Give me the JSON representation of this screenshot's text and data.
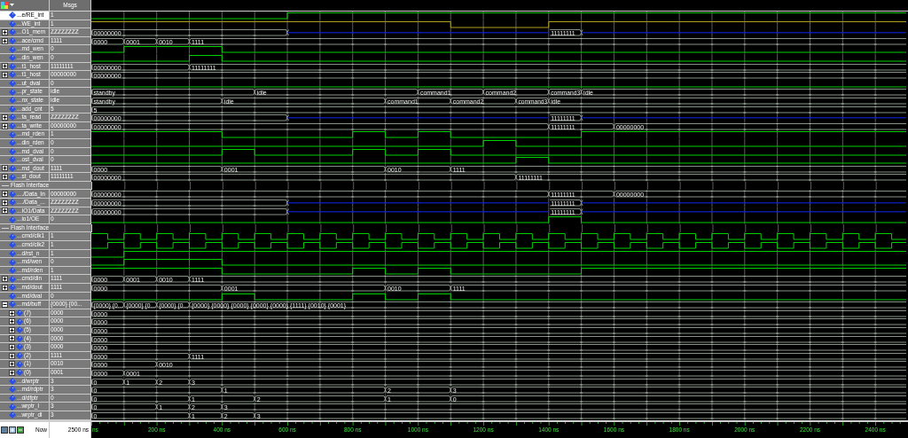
{
  "header": {
    "value_column": "Msgs"
  },
  "signals": [
    {
      "name": "...e/RE_int",
      "value": "1",
      "kind": "bit",
      "selected": true,
      "high": [
        false,
        false,
        false,
        false,
        false,
        false,
        true,
        true,
        true,
        true,
        true,
        true,
        true,
        true,
        true,
        true,
        true,
        true,
        true,
        true,
        true,
        true,
        true,
        true,
        true
      ]
    },
    {
      "name": "...WE_int",
      "value": "1",
      "kind": "bit",
      "selected": false,
      "color": "#b0a020",
      "high": [
        true,
        true,
        true,
        true,
        true,
        true,
        true,
        true,
        true,
        true,
        true,
        false,
        false,
        false,
        true,
        true,
        true,
        true,
        true,
        true,
        true,
        true,
        true,
        true,
        true
      ]
    },
    {
      "name": "...O1_mem",
      "value": "ZZZZZZZZ",
      "kind": "bus",
      "selected": false,
      "expanded": false,
      "changes": [
        true,
        false,
        false,
        false,
        false,
        false,
        true,
        false,
        false,
        false,
        false,
        false,
        false,
        false,
        true,
        true,
        false,
        false,
        false,
        false,
        false,
        false,
        false,
        false,
        false
      ],
      "segments": [
        {
          "hi_z": false,
          "label": "00000000"
        },
        {
          "hi_z": true
        },
        {
          "hi_z": false,
          "label": "11111111"
        },
        {
          "hi_z": true
        }
      ]
    },
    {
      "name": "...ace/cmd",
      "value": "1111",
      "kind": "bus",
      "selected": false,
      "expanded": false,
      "changes": [
        true,
        true,
        true,
        true,
        false,
        false,
        false,
        false,
        false,
        false,
        false,
        false,
        false,
        false,
        false,
        false,
        false,
        false,
        false,
        false,
        false,
        false,
        false,
        false,
        false
      ],
      "segments": [
        {
          "hi_z": false,
          "label": "0000"
        },
        {
          "hi_z": false,
          "label": "0001"
        },
        {
          "hi_z": false,
          "label": "0010"
        },
        {
          "hi_z": false,
          "label": "1111"
        }
      ]
    },
    {
      "name": "...md_wen",
      "value": "0",
      "kind": "bit",
      "selected": false,
      "high": [
        false,
        true,
        true,
        true,
        false,
        false,
        false,
        false,
        false,
        false,
        false,
        false,
        false,
        false,
        false,
        false,
        false,
        false,
        false,
        false,
        false,
        false,
        false,
        false,
        false
      ]
    },
    {
      "name": "...din_wen",
      "value": "0",
      "kind": "bit",
      "selected": false,
      "high": [
        false,
        false,
        false,
        true,
        false,
        false,
        false,
        false,
        false,
        false,
        false,
        false,
        false,
        false,
        false,
        false,
        false,
        false,
        false,
        false,
        false,
        false,
        false,
        false,
        false
      ]
    },
    {
      "name": "...t1_host",
      "value": "11111111",
      "kind": "bus",
      "selected": false,
      "expanded": false,
      "changes": [
        true,
        false,
        false,
        true,
        false,
        false,
        false,
        false,
        false,
        false,
        false,
        false,
        false,
        false,
        false,
        false,
        false,
        false,
        false,
        false,
        false,
        false,
        false,
        false,
        false
      ],
      "segments": [
        {
          "hi_z": false,
          "label": "00000000"
        },
        {
          "hi_z": false,
          "label": "11111111"
        }
      ]
    },
    {
      "name": "...t1_host",
      "value": "00000000",
      "kind": "bus",
      "selected": false,
      "expanded": false,
      "changes": [
        true,
        false,
        false,
        false,
        false,
        false,
        false,
        false,
        false,
        false,
        false,
        false,
        false,
        false,
        false,
        false,
        false,
        false,
        false,
        false,
        false,
        false,
        false,
        false,
        false
      ],
      "segments": [
        {
          "hi_z": false,
          "label": "00000000"
        }
      ]
    },
    {
      "name": "...ut_dval",
      "value": "0",
      "kind": "bit",
      "selected": false,
      "high": [
        false,
        false,
        false,
        false,
        false,
        false,
        false,
        false,
        false,
        false,
        false,
        false,
        false,
        false,
        false,
        false,
        false,
        false,
        false,
        false,
        false,
        false,
        false,
        false,
        false
      ]
    },
    {
      "name": "...pr_state",
      "value": "idle",
      "kind": "bus",
      "selected": false,
      "changes": [
        true,
        false,
        false,
        false,
        false,
        true,
        false,
        false,
        false,
        false,
        true,
        false,
        true,
        false,
        true,
        true,
        false,
        false,
        false,
        false,
        false,
        false,
        false,
        false,
        false
      ],
      "segments": [
        {
          "hi_z": false,
          "label": "standby"
        },
        {
          "hi_z": false,
          "label": "idle"
        },
        {
          "hi_z": false,
          "label": "command1"
        },
        {
          "hi_z": false,
          "label": "command2"
        },
        {
          "hi_z": false,
          "label": "command3"
        },
        {
          "hi_z": false,
          "label": "idle"
        }
      ]
    },
    {
      "name": "...nx_state",
      "value": "idle",
      "kind": "bus",
      "selected": false,
      "changes": [
        true,
        false,
        false,
        false,
        true,
        false,
        false,
        false,
        false,
        true,
        false,
        true,
        false,
        true,
        true,
        false,
        false,
        false,
        false,
        false,
        false,
        false,
        false,
        false,
        false
      ],
      "segments": [
        {
          "hi_z": false,
          "label": "standby"
        },
        {
          "hi_z": false,
          "label": "idle"
        },
        {
          "hi_z": false,
          "label": "command1"
        },
        {
          "hi_z": false,
          "label": "command2"
        },
        {
          "hi_z": false,
          "label": "command3"
        },
        {
          "hi_z": false,
          "label": "idle"
        }
      ]
    },
    {
      "name": "...add_cnt",
      "value": "5",
      "kind": "bus",
      "selected": false,
      "changes": [
        true,
        false,
        false,
        false,
        false,
        false,
        false,
        false,
        false,
        false,
        false,
        false,
        false,
        false,
        false,
        false,
        false,
        false,
        false,
        false,
        false,
        false,
        false,
        false,
        false
      ],
      "segments": [
        {
          "hi_z": false,
          "label": "5"
        }
      ]
    },
    {
      "name": "...ta_read",
      "value": "ZZZZZZZZ",
      "kind": "bus",
      "selected": false,
      "expanded": false,
      "changes": [
        true,
        false,
        false,
        false,
        false,
        false,
        true,
        false,
        false,
        false,
        false,
        false,
        false,
        false,
        true,
        true,
        false,
        false,
        false,
        false,
        false,
        false,
        false,
        false,
        false
      ],
      "segments": [
        {
          "hi_z": false,
          "label": "00000000"
        },
        {
          "hi_z": true
        },
        {
          "hi_z": false,
          "label": "11111111"
        },
        {
          "hi_z": true
        }
      ]
    },
    {
      "name": "...ta_write",
      "value": "00000000",
      "kind": "bus",
      "selected": false,
      "expanded": false,
      "changes": [
        true,
        false,
        false,
        false,
        false,
        false,
        false,
        false,
        false,
        false,
        false,
        false,
        false,
        false,
        true,
        false,
        true,
        false,
        false,
        false,
        false,
        false,
        false,
        false,
        false
      ],
      "segments": [
        {
          "hi_z": false,
          "label": "00000000"
        },
        {
          "hi_z": false,
          "label": "11111111"
        },
        {
          "hi_z": false,
          "label": "00000000"
        }
      ]
    },
    {
      "name": "...md_rden",
      "value": "1",
      "kind": "bit",
      "selected": false,
      "high": [
        true,
        true,
        true,
        true,
        false,
        false,
        false,
        false,
        true,
        false,
        true,
        false,
        false,
        false,
        false,
        true,
        true,
        true,
        true,
        true,
        true,
        true,
        true,
        true,
        true
      ]
    },
    {
      "name": "...din_rden",
      "value": "0",
      "kind": "bit",
      "selected": false,
      "high": [
        false,
        false,
        false,
        false,
        false,
        false,
        false,
        false,
        false,
        false,
        false,
        false,
        true,
        false,
        false,
        false,
        false,
        false,
        false,
        false,
        false,
        false,
        false,
        false,
        false
      ]
    },
    {
      "name": "...md_dval",
      "value": "0",
      "kind": "bit",
      "selected": false,
      "high": [
        false,
        false,
        false,
        false,
        true,
        false,
        false,
        false,
        true,
        false,
        true,
        false,
        false,
        false,
        false,
        false,
        false,
        false,
        false,
        false,
        false,
        false,
        false,
        false,
        false
      ]
    },
    {
      "name": "...ost_dval",
      "value": "0",
      "kind": "bit",
      "selected": false,
      "high": [
        false,
        false,
        false,
        false,
        false,
        false,
        false,
        false,
        false,
        false,
        false,
        false,
        false,
        true,
        false,
        false,
        false,
        false,
        false,
        false,
        false,
        false,
        false,
        false,
        false
      ]
    },
    {
      "name": "...md_dout",
      "value": "1111",
      "kind": "bus",
      "selected": false,
      "expanded": false,
      "changes": [
        true,
        false,
        false,
        false,
        true,
        false,
        false,
        false,
        false,
        true,
        false,
        true,
        false,
        false,
        false,
        false,
        false,
        false,
        false,
        false,
        false,
        false,
        false,
        false,
        false
      ],
      "segments": [
        {
          "hi_z": false,
          "label": "0000"
        },
        {
          "hi_z": false,
          "label": "0001"
        },
        {
          "hi_z": false,
          "label": "0010"
        },
        {
          "hi_z": false,
          "label": "1111"
        }
      ]
    },
    {
      "name": "...st_dout",
      "value": "11111111",
      "kind": "bus",
      "selected": false,
      "expanded": false,
      "changes": [
        true,
        false,
        false,
        false,
        false,
        false,
        false,
        false,
        false,
        false,
        false,
        false,
        false,
        true,
        false,
        false,
        false,
        false,
        false,
        false,
        false,
        false,
        false,
        false,
        false
      ],
      "segments": [
        {
          "hi_z": false,
          "label": "00000000"
        },
        {
          "hi_z": false,
          "label": "11111111"
        }
      ]
    },
    {
      "name": "Flash Interface",
      "kind": "divider",
      "selected": false
    },
    {
      "name": "..../Data_In",
      "value": "00000000",
      "kind": "bus",
      "selected": false,
      "expanded": false,
      "changes": [
        true,
        false,
        false,
        false,
        false,
        false,
        false,
        false,
        false,
        false,
        false,
        false,
        false,
        false,
        true,
        false,
        true,
        false,
        false,
        false,
        false,
        false,
        false,
        false,
        false
      ],
      "segments": [
        {
          "hi_z": false,
          "label": "00000000"
        },
        {
          "hi_z": false,
          "label": "11111111"
        },
        {
          "hi_z": false,
          "label": "00000000"
        }
      ]
    },
    {
      "name": "..../Data_...",
      "value": "ZZZZZZZZ",
      "kind": "bus",
      "selected": false,
      "expanded": false,
      "changes": [
        true,
        false,
        false,
        false,
        false,
        false,
        true,
        false,
        false,
        false,
        false,
        false,
        false,
        false,
        true,
        true,
        false,
        false,
        false,
        false,
        false,
        false,
        false,
        false,
        false
      ],
      "segments": [
        {
          "hi_z": false,
          "label": "00000000"
        },
        {
          "hi_z": true
        },
        {
          "hi_z": false,
          "label": "11111111"
        },
        {
          "hi_z": true
        }
      ]
    },
    {
      "name": "...IO1/Data",
      "value": "ZZZZZZZZ",
      "kind": "bus",
      "selected": false,
      "expanded": false,
      "changes": [
        true,
        false,
        false,
        false,
        false,
        false,
        true,
        false,
        false,
        false,
        false,
        false,
        false,
        false,
        true,
        true,
        false,
        false,
        false,
        false,
        false,
        false,
        false,
        false,
        false
      ],
      "segments": [
        {
          "hi_z": false,
          "label": "00000000"
        },
        {
          "hi_z": true
        },
        {
          "hi_z": false,
          "label": "11111111"
        },
        {
          "hi_z": true
        }
      ]
    },
    {
      "name": "...io1/OE",
      "value": "0",
      "kind": "bit",
      "selected": false,
      "high": [
        false,
        false,
        false,
        false,
        false,
        false,
        false,
        false,
        false,
        false,
        false,
        false,
        false,
        false,
        true,
        false,
        false,
        false,
        false,
        false,
        false,
        false,
        false,
        false,
        false
      ]
    },
    {
      "name": "Flash Interface",
      "kind": "divider",
      "selected": false
    },
    {
      "name": "...cmd/clk1",
      "value": "1",
      "kind": "clock",
      "selected": false,
      "inverted": false
    },
    {
      "name": "...cmd/clk2",
      "value": "1",
      "kind": "clock",
      "selected": false,
      "inverted": true
    },
    {
      "name": "...d/rst_n",
      "value": "1",
      "kind": "bit",
      "selected": false,
      "high": [
        false,
        true,
        true,
        true,
        true,
        true,
        true,
        true,
        true,
        true,
        true,
        true,
        true,
        true,
        true,
        true,
        true,
        true,
        true,
        true,
        true,
        true,
        true,
        true,
        true
      ]
    },
    {
      "name": "...md/wen",
      "value": "0",
      "kind": "bit",
      "selected": false,
      "high": [
        false,
        true,
        true,
        true,
        false,
        false,
        false,
        false,
        false,
        false,
        false,
        false,
        false,
        false,
        false,
        false,
        false,
        false,
        false,
        false,
        false,
        false,
        false,
        false,
        false
      ]
    },
    {
      "name": "...md/rden",
      "value": "1",
      "kind": "bit",
      "selected": false,
      "high": [
        true,
        true,
        true,
        true,
        false,
        false,
        false,
        false,
        true,
        false,
        true,
        false,
        false,
        false,
        false,
        true,
        true,
        true,
        true,
        true,
        true,
        true,
        true,
        true,
        true
      ]
    },
    {
      "name": "...cmd/din",
      "value": "1111",
      "kind": "bus",
      "selected": false,
      "expanded": false,
      "changes": [
        true,
        true,
        true,
        true,
        false,
        false,
        false,
        false,
        false,
        false,
        false,
        false,
        false,
        false,
        false,
        false,
        false,
        false,
        false,
        false,
        false,
        false,
        false,
        false,
        false
      ],
      "segments": [
        {
          "hi_z": false,
          "label": "0000"
        },
        {
          "hi_z": false,
          "label": "0001"
        },
        {
          "hi_z": false,
          "label": "0010"
        },
        {
          "hi_z": false,
          "label": "1111"
        }
      ]
    },
    {
      "name": "...md/dout",
      "value": "1111",
      "kind": "bus",
      "selected": false,
      "expanded": false,
      "changes": [
        true,
        false,
        false,
        false,
        true,
        false,
        false,
        false,
        false,
        true,
        false,
        true,
        false,
        false,
        false,
        false,
        false,
        false,
        false,
        false,
        false,
        false,
        false,
        false,
        false
      ],
      "segments": [
        {
          "hi_z": false,
          "label": "0000"
        },
        {
          "hi_z": false,
          "label": "0001"
        },
        {
          "hi_z": false,
          "label": "0010"
        },
        {
          "hi_z": false,
          "label": "1111"
        }
      ]
    },
    {
      "name": "...md/dval",
      "value": "0",
      "kind": "bit",
      "selected": false,
      "high": [
        false,
        false,
        false,
        false,
        true,
        false,
        false,
        false,
        true,
        false,
        true,
        false,
        false,
        false,
        false,
        false,
        false,
        false,
        false,
        false,
        false,
        false,
        false,
        false,
        false
      ]
    },
    {
      "name": "...md/buff",
      "value": "{0000} {00...",
      "kind": "bus",
      "selected": false,
      "expanded": true,
      "changes": [
        true,
        true,
        true,
        true,
        false,
        false,
        false,
        false,
        false,
        false,
        false,
        false,
        false,
        false,
        false,
        false,
        false,
        false,
        false,
        false,
        false,
        false,
        false,
        false,
        false
      ],
      "segments": [
        {
          "hi_z": false,
          "label": "{0000} {0..."
        },
        {
          "hi_z": false,
          "label": "{0000} {0..."
        },
        {
          "hi_z": false,
          "label": "{0000} {0..."
        },
        {
          "hi_z": false,
          "label": "{0000} {0000} {0000} {0000} {0000} {1111} {0010} {0001}"
        }
      ],
      "children": [
        {
          "name": "(7)",
          "value": "0000",
          "kind": "bus",
          "selected": false,
          "expanded": false,
          "changes": [
            true,
            false,
            false,
            false,
            false,
            false,
            false,
            false,
            false,
            false,
            false,
            false,
            false,
            false,
            false,
            false,
            false,
            false,
            false,
            false,
            false,
            false,
            false,
            false,
            false
          ],
          "segments": [
            {
              "hi_z": false,
              "label": "0000"
            }
          ]
        },
        {
          "name": "(6)",
          "value": "0000",
          "kind": "bus",
          "selected": false,
          "expanded": false,
          "changes": [
            true,
            false,
            false,
            false,
            false,
            false,
            false,
            false,
            false,
            false,
            false,
            false,
            false,
            false,
            false,
            false,
            false,
            false,
            false,
            false,
            false,
            false,
            false,
            false,
            false
          ],
          "segments": [
            {
              "hi_z": false,
              "label": "0000"
            }
          ]
        },
        {
          "name": "(5)",
          "value": "0000",
          "kind": "bus",
          "selected": false,
          "expanded": false,
          "changes": [
            true,
            false,
            false,
            false,
            false,
            false,
            false,
            false,
            false,
            false,
            false,
            false,
            false,
            false,
            false,
            false,
            false,
            false,
            false,
            false,
            false,
            false,
            false,
            false,
            false
          ],
          "segments": [
            {
              "hi_z": false,
              "label": "0000"
            }
          ]
        },
        {
          "name": "(4)",
          "value": "0000",
          "kind": "bus",
          "selected": false,
          "expanded": false,
          "changes": [
            true,
            false,
            false,
            false,
            false,
            false,
            false,
            false,
            false,
            false,
            false,
            false,
            false,
            false,
            false,
            false,
            false,
            false,
            false,
            false,
            false,
            false,
            false,
            false,
            false
          ],
          "segments": [
            {
              "hi_z": false,
              "label": "0000"
            }
          ]
        },
        {
          "name": "(3)",
          "value": "0000",
          "kind": "bus",
          "selected": false,
          "expanded": false,
          "changes": [
            true,
            false,
            false,
            false,
            false,
            false,
            false,
            false,
            false,
            false,
            false,
            false,
            false,
            false,
            false,
            false,
            false,
            false,
            false,
            false,
            false,
            false,
            false,
            false,
            false
          ],
          "segments": [
            {
              "hi_z": false,
              "label": "0000"
            }
          ]
        },
        {
          "name": "(2)",
          "value": "1111",
          "kind": "bus",
          "selected": false,
          "expanded": false,
          "changes": [
            true,
            false,
            false,
            true,
            false,
            false,
            false,
            false,
            false,
            false,
            false,
            false,
            false,
            false,
            false,
            false,
            false,
            false,
            false,
            false,
            false,
            false,
            false,
            false,
            false
          ],
          "segments": [
            {
              "hi_z": false,
              "label": "0000"
            },
            {
              "hi_z": false,
              "label": "1111"
            }
          ]
        },
        {
          "name": "(1)",
          "value": "0010",
          "kind": "bus",
          "selected": false,
          "expanded": false,
          "changes": [
            true,
            false,
            true,
            false,
            false,
            false,
            false,
            false,
            false,
            false,
            false,
            false,
            false,
            false,
            false,
            false,
            false,
            false,
            false,
            false,
            false,
            false,
            false,
            false,
            false
          ],
          "segments": [
            {
              "hi_z": false,
              "label": "0000"
            },
            {
              "hi_z": false,
              "label": "0010"
            }
          ]
        },
        {
          "name": "(0)",
          "value": "0001",
          "kind": "bus",
          "selected": false,
          "expanded": false,
          "changes": [
            true,
            true,
            false,
            false,
            false,
            false,
            false,
            false,
            false,
            false,
            false,
            false,
            false,
            false,
            false,
            false,
            false,
            false,
            false,
            false,
            false,
            false,
            false,
            false,
            false
          ],
          "segments": [
            {
              "hi_z": false,
              "label": "0000"
            },
            {
              "hi_z": false,
              "label": "0001"
            }
          ]
        }
      ]
    },
    {
      "name": "...d/wrptr",
      "value": "3",
      "kind": "bus",
      "selected": false,
      "changes": [
        true,
        true,
        true,
        true,
        false,
        false,
        false,
        false,
        false,
        false,
        false,
        false,
        false,
        false,
        false,
        false,
        false,
        false,
        false,
        false,
        false,
        false,
        false,
        false,
        false
      ],
      "segments": [
        {
          "hi_z": false,
          "label": "0"
        },
        {
          "hi_z": false,
          "label": "1"
        },
        {
          "hi_z": false,
          "label": "2"
        },
        {
          "hi_z": false,
          "label": "3"
        }
      ]
    },
    {
      "name": "...md/rdptr",
      "value": "3",
      "kind": "bus",
      "selected": false,
      "changes": [
        true,
        false,
        false,
        false,
        true,
        false,
        false,
        false,
        false,
        true,
        false,
        true,
        false,
        false,
        false,
        false,
        false,
        false,
        false,
        false,
        false,
        false,
        false,
        false,
        false
      ],
      "segments": [
        {
          "hi_z": false,
          "label": "0"
        },
        {
          "hi_z": false,
          "label": "1"
        },
        {
          "hi_z": false,
          "label": "2"
        },
        {
          "hi_z": false,
          "label": "3"
        }
      ]
    },
    {
      "name": "...d/dfptr",
      "value": "0",
      "kind": "bus",
      "selected": false,
      "changes": [
        true,
        false,
        false,
        true,
        false,
        true,
        false,
        false,
        false,
        true,
        false,
        true,
        false,
        false,
        false,
        false,
        false,
        false,
        false,
        false,
        false,
        false,
        false,
        false,
        false
      ],
      "segments": [
        {
          "hi_z": false,
          "label": "0"
        },
        {
          "hi_z": false,
          "label": "1"
        },
        {
          "hi_z": false,
          "label": "2"
        },
        {
          "hi_z": false,
          "label": "1"
        },
        {
          "hi_z": false,
          "label": "0"
        }
      ]
    },
    {
      "name": "...wrptr_l",
      "value": "3",
      "kind": "bus",
      "selected": false,
      "changes": [
        true,
        false,
        true,
        true,
        true,
        false,
        false,
        false,
        false,
        false,
        false,
        false,
        false,
        false,
        false,
        false,
        false,
        false,
        false,
        false,
        false,
        false,
        false,
        false,
        false
      ],
      "segments": [
        {
          "hi_z": false,
          "label": "0"
        },
        {
          "hi_z": false,
          "label": "1"
        },
        {
          "hi_z": false,
          "label": "2"
        },
        {
          "hi_z": false,
          "label": "3"
        }
      ]
    },
    {
      "name": "...wrptr_dl",
      "value": "3",
      "kind": "bus",
      "selected": false,
      "changes": [
        true,
        false,
        false,
        true,
        true,
        true,
        false,
        false,
        false,
        false,
        false,
        false,
        false,
        false,
        false,
        false,
        false,
        false,
        false,
        false,
        false,
        false,
        false,
        false,
        false
      ],
      "segments": [
        {
          "hi_z": false,
          "label": "0"
        },
        {
          "hi_z": false,
          "label": "1"
        },
        {
          "hi_z": false,
          "label": "2"
        },
        {
          "hi_z": false,
          "label": "3"
        }
      ]
    }
  ],
  "footer": {
    "now_label": "Now",
    "now_value": "2500 ns",
    "ticks": [
      "ns",
      "200 ns",
      "400 ns",
      "600 ns",
      "800 ns",
      "1000 ns",
      "1200 ns",
      "1400 ns",
      "1600 ns",
      "1800 ns",
      "2000 ns",
      "2200 ns",
      "2400 ns"
    ]
  }
}
